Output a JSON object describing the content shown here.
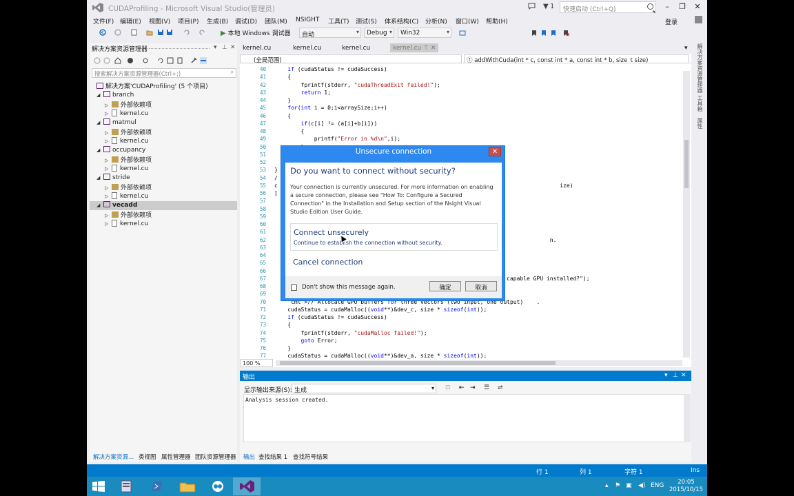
{
  "window": {
    "title": "CUDAProfiling - Microsoft Visual Studio(管理员)",
    "flag_count": "1",
    "quick_launch_placeholder": "快速启动 (Ctrl+Q)",
    "signin": "登录"
  },
  "menu": [
    "文件(F)",
    "编辑(E)",
    "视图(V)",
    "项目(P)",
    "生成(B)",
    "调试(D)",
    "团队(M)",
    "NSIGHT",
    "工具(T)",
    "测试(S)",
    "体系结构(C)",
    "分析(N)",
    "窗口(W)",
    "帮助(H)"
  ],
  "toolbar": {
    "run_label": "本地 Windows 调试器",
    "run_mode": "自动",
    "config": "Debug",
    "platform": "Win32"
  },
  "solution_explorer": {
    "title": "解决方案资源管理器",
    "search_placeholder": "搜索解决方案资源管理器(Ctrl+;)",
    "solution_label": "解决方案'CUDAProfiling' (5 个项目)",
    "projects": [
      {
        "name": "branch",
        "children": [
          "外部依赖项",
          "kernel.cu"
        ]
      },
      {
        "name": "matmul",
        "children": [
          "外部依赖项",
          "kernel.cu"
        ]
      },
      {
        "name": "occupancy",
        "children": [
          "外部依赖项",
          "kernel.cu"
        ]
      },
      {
        "name": "stride",
        "children": [
          "外部依赖项",
          "kernel.cu"
        ]
      },
      {
        "name": "vecadd",
        "children": [
          "外部依赖项",
          "kernel.cu"
        ],
        "selected": true
      }
    ],
    "bottom_tabs": [
      "解决方案资源...",
      "类视图",
      "属性管理器",
      "团队资源管理器"
    ]
  },
  "editor": {
    "tabs": [
      "kernel.cu",
      "kernel.cu",
      "kernel.cu",
      "kernel.cu"
    ],
    "scope": "(全局范围)",
    "member": "addWithCuda(int * c, const int * a, const int * b, size_t size)",
    "zoom": "100 %",
    "lines": [
      {
        "n": "40",
        "t": "    if (cudaStatus != cudaSuccess)"
      },
      {
        "n": "41",
        "t": "    {"
      },
      {
        "n": "42",
        "t": "        fprintf(stderr, \"cudaThreadExit failed!\");"
      },
      {
        "n": "43",
        "t": "        return 1;"
      },
      {
        "n": "44",
        "t": "    }"
      },
      {
        "n": "45",
        "t": "    for(int i = 0;i<arraySize;i++)"
      },
      {
        "n": "46",
        "t": "    {"
      },
      {
        "n": "47",
        "t": "        if(c[i] != (a[i]+b[i]))"
      },
      {
        "n": "48",
        "t": "        {"
      },
      {
        "n": "49",
        "t": "            printf(\"Error in %d\\n\",i);"
      },
      {
        "n": "50",
        "t": "        }"
      },
      {
        "n": "51",
        "t": ""
      },
      {
        "n": "52",
        "t": ""
      },
      {
        "n": "53",
        "t": "}"
      },
      {
        "n": "54",
        "t": "/"
      },
      {
        "n": "55",
        "t": "c                                                                                     ize)"
      },
      {
        "n": "56",
        "t": "["
      },
      {
        "n": "57",
        "t": ""
      },
      {
        "n": "58",
        "t": ""
      },
      {
        "n": "59",
        "t": ""
      },
      {
        "n": "60",
        "t": ""
      },
      {
        "n": "61",
        "t": ""
      },
      {
        "n": "62",
        "t": "                                                                                   n."
      },
      {
        "n": "63",
        "t": ""
      },
      {
        "n": "64",
        "t": ""
      },
      {
        "n": "65",
        "t": ""
      },
      {
        "n": "66",
        "t": ""
      },
      {
        "n": "67",
        "t": "                                                                      capable GPU installed?\");"
      },
      {
        "n": "68",
        "t": ""
      },
      {
        "n": "69",
        "t": ""
      },
      {
        "n": "70",
        "t": "    // Allocate GPU buffers for three vectors (two input, one output)    ."
      },
      {
        "n": "71",
        "t": "    cudaStatus = cudaMalloc((void**)&dev_c, size * sizeof(int));"
      },
      {
        "n": "72",
        "t": "    if (cudaStatus != cudaSuccess)"
      },
      {
        "n": "73",
        "t": "    {"
      },
      {
        "n": "74",
        "t": "        fprintf(stderr, \"cudaMalloc failed!\");"
      },
      {
        "n": "75",
        "t": "        goto Error;"
      },
      {
        "n": "76",
        "t": "    }"
      },
      {
        "n": "77",
        "t": "    cudaStatus = cudaMalloc((void**)&dev_a, size * sizeof(int));"
      }
    ]
  },
  "right_tabs": [
    "解决方案资源管理器",
    "工具箱",
    "属性"
  ],
  "output": {
    "title": "输出",
    "source_label": "显示输出来源(S):",
    "source_value": "生成",
    "body": "Analysis session created.",
    "tabs": [
      "输出",
      "查找结果 1",
      "查找符号结果"
    ]
  },
  "status": {
    "line": "行 1",
    "col": "列 1",
    "char": "字符 1",
    "ins": "Ins"
  },
  "taskbar": {
    "lang": "ENG",
    "time": "20:05",
    "date": "2015/10/15"
  },
  "dialog": {
    "title": "Unsecure connection",
    "heading": "Do you want to connect without security?",
    "message": "Your connection is currently unsecured.  For more information on enabling a secure connection, please see \"How To: Configure a Secured Connection\" in the Installation and Setup section of the Nsight Visual Studio Edition User Guide.",
    "option1_title": "Connect unsecurely",
    "option1_sub": "Continue to establish the connection without security.",
    "option2_title": "Cancel connection",
    "checkbox_label": "Don't show this message again.",
    "ok": "确定",
    "cancel": "取消",
    "close": "✕"
  },
  "colors": {
    "accent": "#007acc",
    "dialog_frame": "#2d89ef",
    "taskbar": "#1a8bbf"
  }
}
